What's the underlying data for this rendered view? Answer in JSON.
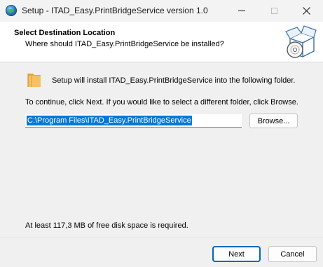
{
  "window": {
    "title": "Setup - ITAD_Easy.PrintBridgeService version 1.0",
    "controls": {
      "minimize": "—",
      "maximize": "☐",
      "close": "✕"
    }
  },
  "header": {
    "title": "Select Destination Location",
    "subtitle": "Where should ITAD_Easy.PrintBridgeService be installed?",
    "image_icon": "setup-box-cd-icon"
  },
  "main": {
    "folder_icon": "folder-icon",
    "install_text": "Setup will install ITAD_Easy.PrintBridgeService into the following folder.",
    "continue_text": "To continue, click Next. If you would like to select a different folder, click Browse.",
    "path_value": "C:\\Program Files\\ITAD_Easy.PrintBridgeService",
    "browse_label": "Browse...",
    "disk_space_text": "At least 117,3 MB of free disk space is required."
  },
  "footer": {
    "next_label": "Next",
    "cancel_label": "Cancel"
  },
  "colors": {
    "accent": "#0067c0",
    "selection": "#0078d7",
    "folder": "#f5b74a"
  }
}
